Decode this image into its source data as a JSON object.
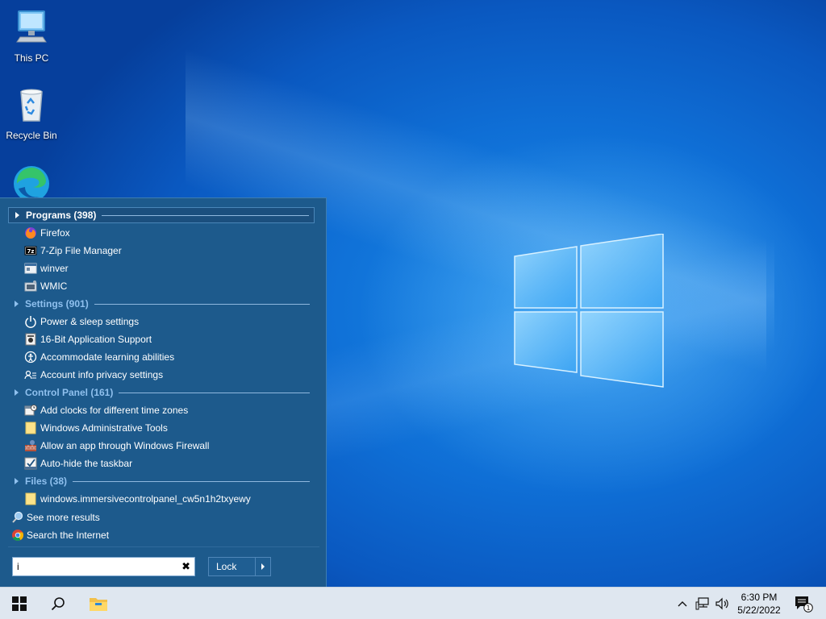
{
  "desktop": {
    "icons": [
      {
        "label": "This PC",
        "icon": "computer-icon"
      },
      {
        "label": "Recycle Bin",
        "icon": "recycle-bin-icon"
      },
      {
        "label": "",
        "icon": "edge-icon"
      }
    ]
  },
  "start_menu": {
    "sections": [
      {
        "title": "Programs (398)",
        "active": true,
        "items": [
          {
            "label": "Firefox",
            "icon": "firefox-icon"
          },
          {
            "label": "7-Zip File Manager",
            "icon": "7zip-icon"
          },
          {
            "label": "winver",
            "icon": "window-app-icon"
          },
          {
            "label": "WMIC",
            "icon": "wmic-icon"
          }
        ]
      },
      {
        "title": "Settings (901)",
        "active": false,
        "items": [
          {
            "label": "Power & sleep settings",
            "icon": "power-icon"
          },
          {
            "label": "16-Bit Application Support",
            "icon": "app-support-icon"
          },
          {
            "label": "Accommodate learning abilities",
            "icon": "ease-of-access-icon"
          },
          {
            "label": "Account info privacy settings",
            "icon": "account-privacy-icon"
          }
        ]
      },
      {
        "title": "Control Panel (161)",
        "active": false,
        "items": [
          {
            "label": "Add clocks for different time zones",
            "icon": "clock-calendar-icon"
          },
          {
            "label": "Windows Administrative Tools",
            "icon": "folder-icon"
          },
          {
            "label": "Allow an app through Windows Firewall",
            "icon": "firewall-icon"
          },
          {
            "label": "Auto-hide the taskbar",
            "icon": "taskbar-settings-icon"
          }
        ]
      },
      {
        "title": "Files (38)",
        "active": false,
        "items": [
          {
            "label": "windows.immersivecontrolpanel_cw5n1h2txyewy",
            "icon": "folder-icon"
          }
        ]
      }
    ],
    "see_more": "See more results",
    "search_internet": "Search the Internet",
    "search_value": "i",
    "clear_symbol": "✖",
    "lock_label": "Lock"
  },
  "taskbar": {
    "time": "6:30 PM",
    "date": "5/22/2022",
    "notification_count": "1"
  },
  "colors": {
    "menu_bg": "#1d5a8c",
    "taskbar_bg": "#dfe7f0",
    "desktop_blue": "#0f6fd6"
  }
}
